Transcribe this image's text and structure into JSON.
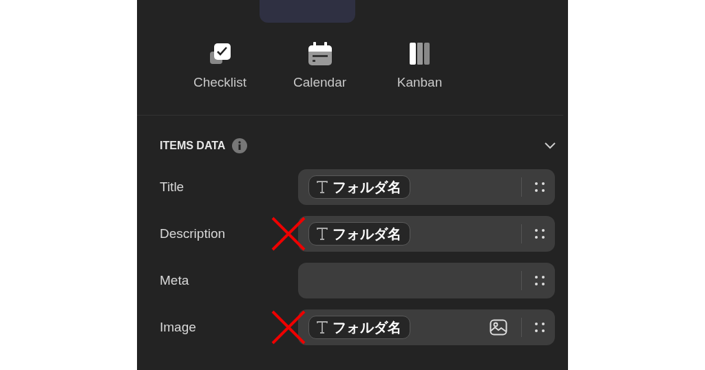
{
  "active_view_tab": {
    "selected": true
  },
  "view_options": [
    {
      "kind": "checklist",
      "label": "Checklist"
    },
    {
      "kind": "calendar",
      "label": "Calendar"
    },
    {
      "kind": "kanban",
      "label": "Kanban"
    }
  ],
  "section": {
    "title": "ITEMS DATA",
    "expanded": true
  },
  "fields": [
    {
      "label": "Title",
      "value": "フォルダ名",
      "image_icon": false,
      "crossed_out": false
    },
    {
      "label": "Description",
      "value": "フォルダ名",
      "image_icon": false,
      "crossed_out": true
    },
    {
      "label": "Meta",
      "image_icon": false,
      "crossed_out": false
    },
    {
      "label": "Image",
      "value": "フォルダ名",
      "image_icon": true,
      "crossed_out": true
    }
  ]
}
